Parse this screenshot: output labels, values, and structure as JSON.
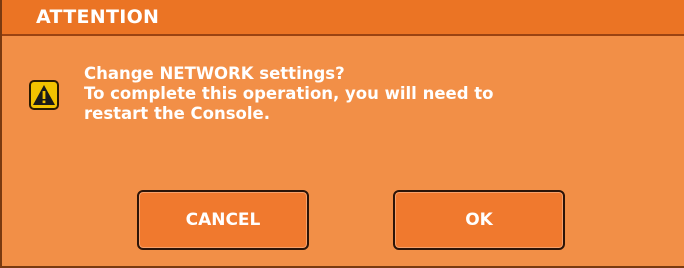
{
  "dialog": {
    "title": "ATTENTION",
    "icon": "warning-triangle-icon",
    "message_lines": [
      "Change NETWORK settings?",
      "To complete this operation, you will need to",
      "restart the Console."
    ],
    "cancel_label": "CANCEL",
    "ok_label": "OK"
  },
  "colors": {
    "dialog_background": "#f28f47",
    "title_bar": "#eb7424",
    "button_face": "#f0792e",
    "warning_icon_fill": "#f2c200",
    "text": "#ffffff"
  }
}
